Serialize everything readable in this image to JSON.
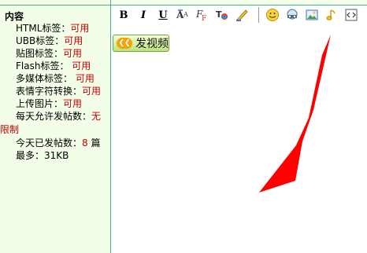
{
  "panel": {
    "title": "内容",
    "html_label": "HTML标签：",
    "html_value": "可用",
    "ubb_label": "UBB标签：",
    "ubb_value": "可用",
    "img_label": "贴图标签：",
    "img_value": "可用",
    "flash_label": "Flash标签：",
    "flash_value": "可用",
    "media_label": "多媒体标签：",
    "media_value": "可用",
    "emoji_label": "表情字符转换：",
    "emoji_value": "可用",
    "upload_label": "上传图片：",
    "upload_value": "可用",
    "daily_label": "每天允许发帖数：",
    "daily_value_1": "无",
    "daily_value_2": "限制",
    "today_label": "今天已发帖数：",
    "today_value": "8",
    "today_unit": " 篇",
    "max_label": "最多：31KB"
  },
  "toolbar": {
    "bold": "B",
    "italic": "I",
    "underline": "U",
    "font_icon": "font-size-icon",
    "font_face_icon": "font-face-icon",
    "text_color_icon": "text-color-icon",
    "highlight_icon": "highlight-pen-icon",
    "emoticon_icon": "smiley-icon",
    "media_icon": "media-icon",
    "image_icon": "image-icon",
    "music_icon": "music-note-icon",
    "source_icon": "source-code-icon"
  },
  "video_button": {
    "label": "发视频"
  },
  "colors": {
    "panel_bg": "#f2fee8",
    "border": "#43b38f",
    "value_red": "#cc0000",
    "annotation_arrow": "#ff0000"
  }
}
